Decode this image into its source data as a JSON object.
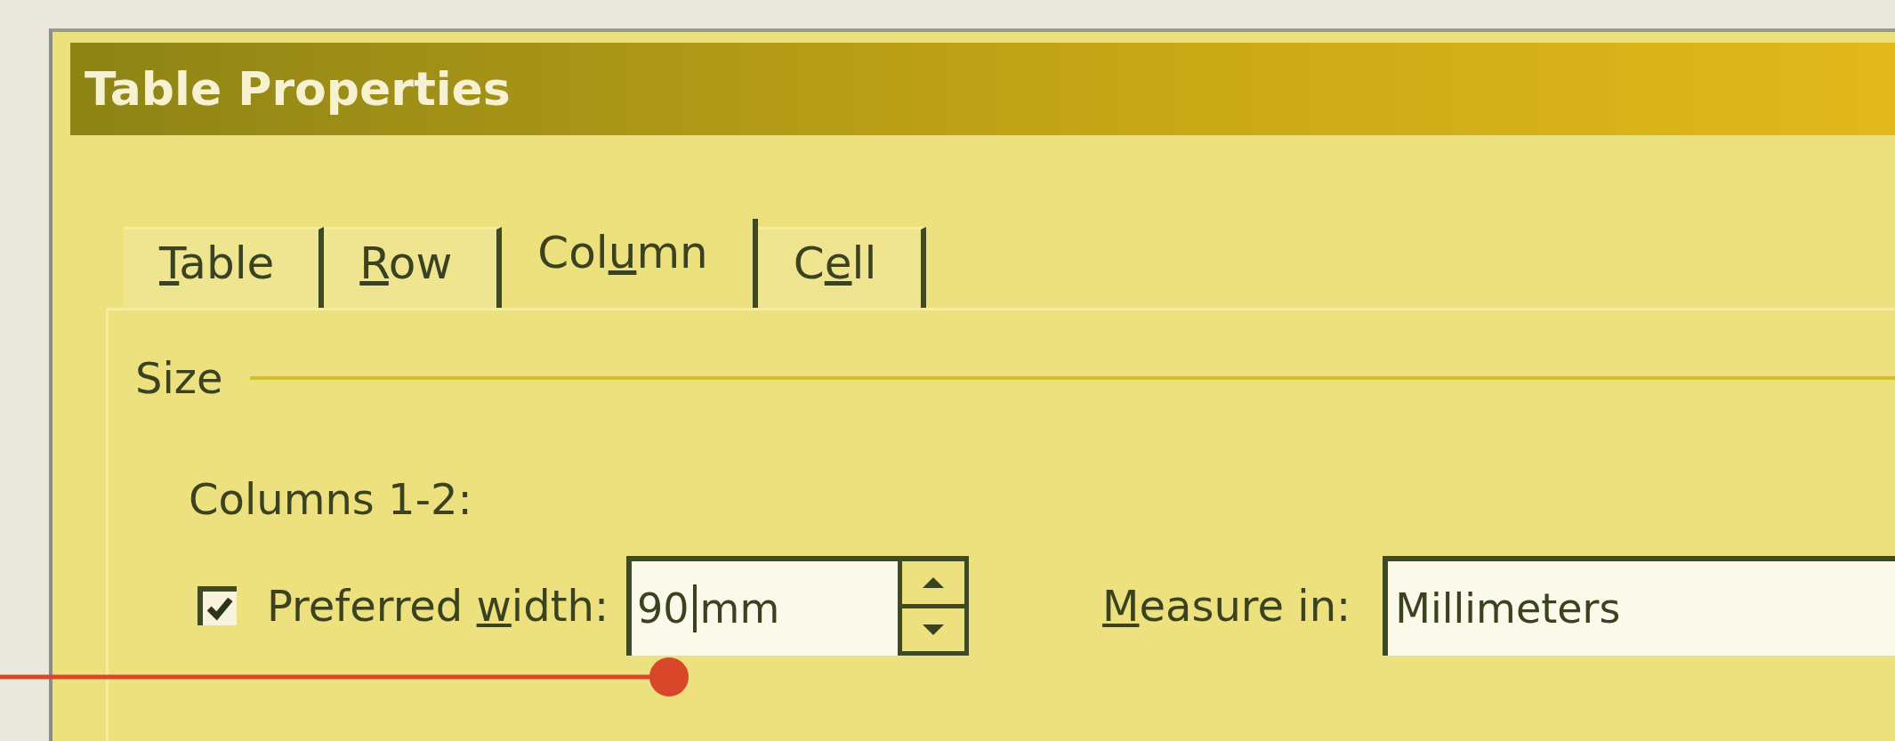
{
  "window": {
    "title": "Table Properties"
  },
  "tabs": [
    {
      "label": {
        "key": "T",
        "after": "able"
      },
      "selected": false
    },
    {
      "label": {
        "key": "R",
        "after": "ow"
      },
      "selected": false
    },
    {
      "label": {
        "before": "Col",
        "key": "u",
        "after": "mn"
      },
      "selected": true
    },
    {
      "label": {
        "before": "C",
        "key": "e",
        "after": "ll"
      },
      "selected": false
    }
  ],
  "size_section": {
    "heading": "Size",
    "columns_label": "Columns 1-2:",
    "preferred_width": {
      "label": {
        "before": "Preferred ",
        "key": "w",
        "after": "idth:"
      },
      "checked": true,
      "value": "90",
      "unit": "mm"
    },
    "measure_in": {
      "label": {
        "key": "M",
        "after": "easure in:"
      },
      "value": "Millimeters"
    }
  }
}
